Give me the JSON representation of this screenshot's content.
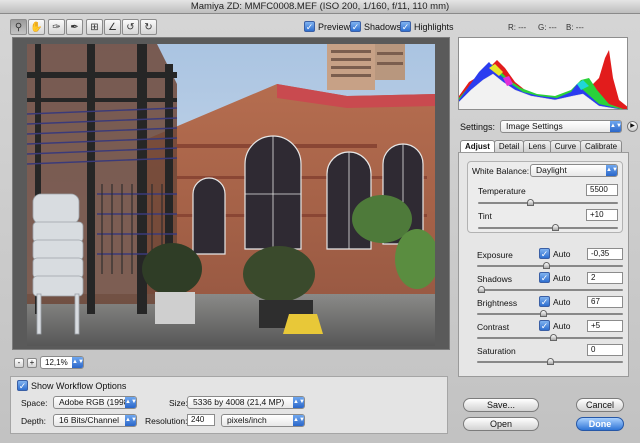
{
  "window": {
    "title": "Mamiya ZD:  MMFC0008.MEF  (ISO 200, 1/160, f/11, 110 mm)"
  },
  "toolbar": {
    "tools": [
      "zoom-tool-icon",
      "hand-tool-icon",
      "white-balance-tool-icon",
      "color-sampler-tool-icon",
      "crop-tool-icon",
      "straighten-tool-icon",
      "rotate-left-icon",
      "rotate-right-icon"
    ],
    "preview_label": "Preview",
    "shadows_label": "Shadows",
    "highlights_label": "Highlights",
    "r_readout": "R: ---",
    "g_readout": "G: ---",
    "b_readout": "B: ---"
  },
  "zoom": {
    "minus": "-",
    "plus": "+",
    "value": "12,1%"
  },
  "settings": {
    "label": "Settings:",
    "value": "Image Settings",
    "tabs": [
      "Adjust",
      "Detail",
      "Lens",
      "Curve",
      "Calibrate"
    ],
    "active_tab": "Adjust"
  },
  "adjust": {
    "white_balance_label": "White Balance:",
    "white_balance_value": "Daylight",
    "auto_label": "Auto",
    "temperature": {
      "label": "Temperature",
      "value": "5500",
      "level": 0.37
    },
    "tint": {
      "label": "Tint",
      "value": "+10",
      "level": 0.55
    },
    "exposure": {
      "label": "Exposure",
      "value": "-0,35",
      "level": 0.47
    },
    "shadows": {
      "label": "Shadows",
      "value": "2",
      "level": 0.03
    },
    "brightness": {
      "label": "Brightness",
      "value": "67",
      "level": 0.45
    },
    "contrast": {
      "label": "Contrast",
      "value": "+5",
      "level": 0.52
    },
    "saturation": {
      "label": "Saturation",
      "value": "0",
      "level": 0.5
    }
  },
  "workflow": {
    "show_label": "Show Workflow Options",
    "space_label": "Space:",
    "space_value": "Adobe RGB (1998)",
    "size_label": "Size:",
    "size_value": "5336 by 4008  (21,4 MP)",
    "depth_label": "Depth:",
    "depth_value": "16 Bits/Channel",
    "resolution_label": "Resolution:",
    "resolution_value": "240",
    "resolution_unit": "pixels/inch"
  },
  "buttons": {
    "save": "Save...",
    "cancel": "Cancel",
    "open": "Open",
    "done": "Done"
  }
}
